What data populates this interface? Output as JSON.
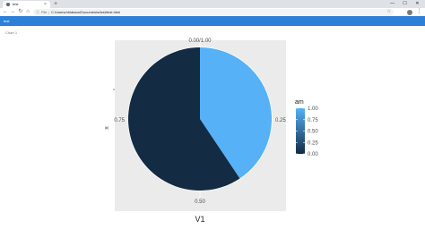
{
  "browser": {
    "tab_title": "test",
    "tab_close": "×",
    "new_tab": "+",
    "window_controls": [
      "—",
      "☐",
      "✕"
    ],
    "nav": {
      "back": "←",
      "forward": "→",
      "reload": "↻",
      "home": "⌂"
    },
    "address": {
      "info_icon": "ⓘ",
      "scheme": "File",
      "separator": "|",
      "url": "C:/Users/nhlatano/Documents/test/test.html"
    },
    "toolbar_icons": [
      "☆",
      "⋮"
    ]
  },
  "app": {
    "title": "test",
    "chart_tab": "Chart 1"
  },
  "chart_data": {
    "type": "pie",
    "xlabel": "V1",
    "ylabel": "x",
    "legend_title": "am",
    "legend_position": "right",
    "legend_ticks": [
      "1.00",
      "0.75",
      "0.50",
      "0.25",
      "0.00"
    ],
    "legend_colors": {
      "low": "#132B43",
      "high": "#56B1F7"
    },
    "theta_ticks": [
      "0.00/1.00",
      "0.25",
      "0.50",
      "0.75"
    ],
    "panel_background": "#ebebeb",
    "grid": true,
    "slices": [
      {
        "am": 1,
        "share": 0.40625,
        "color": "#56B1F7"
      },
      {
        "am": 0,
        "share": 0.59375,
        "color": "#132B43"
      }
    ]
  }
}
